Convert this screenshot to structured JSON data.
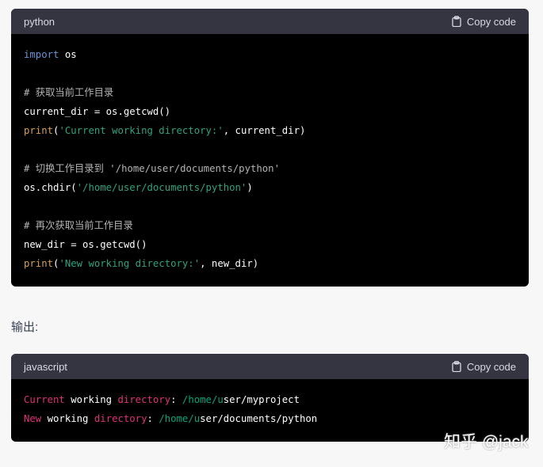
{
  "block1": {
    "lang": "python",
    "copy": "Copy code",
    "lines": [
      [
        {
          "t": "import",
          "c": "kw"
        },
        {
          "t": " os",
          "c": ""
        }
      ],
      [],
      [
        {
          "t": "# 获取当前工作目录",
          "c": "cm"
        }
      ],
      [
        {
          "t": "current_dir = os.getcwd()",
          "c": ""
        }
      ],
      [
        {
          "t": "print",
          "c": "fn"
        },
        {
          "t": "(",
          "c": ""
        },
        {
          "t": "'Current working directory:'",
          "c": "str"
        },
        {
          "t": ", current_dir)",
          "c": ""
        }
      ],
      [],
      [
        {
          "t": "# 切换工作目录到 '/home/user/documents/python'",
          "c": "cm"
        }
      ],
      [
        {
          "t": "os.chdir(",
          "c": ""
        },
        {
          "t": "'/home/user/documents/python'",
          "c": "str"
        },
        {
          "t": ")",
          "c": ""
        }
      ],
      [],
      [
        {
          "t": "# 再次获取当前工作目录",
          "c": "cm"
        }
      ],
      [
        {
          "t": "new_dir = os.getcwd()",
          "c": ""
        }
      ],
      [
        {
          "t": "print",
          "c": "fn"
        },
        {
          "t": "(",
          "c": ""
        },
        {
          "t": "'New working directory:'",
          "c": "str"
        },
        {
          "t": ", new_dir)",
          "c": ""
        }
      ]
    ]
  },
  "output_label": "输出:",
  "block2": {
    "lang": "javascript",
    "copy": "Copy code",
    "lines": [
      [
        {
          "t": "Current",
          "c": "red"
        },
        {
          "t": " working ",
          "c": ""
        },
        {
          "t": "directory",
          "c": "red"
        },
        {
          "t": ": ",
          "c": ""
        },
        {
          "t": "/home/u",
          "c": "grn"
        },
        {
          "t": "ser/myproject",
          "c": ""
        }
      ],
      [
        {
          "t": "New",
          "c": "red"
        },
        {
          "t": " working ",
          "c": ""
        },
        {
          "t": "directory",
          "c": "red"
        },
        {
          "t": ": ",
          "c": ""
        },
        {
          "t": "/home/u",
          "c": "grn"
        },
        {
          "t": "ser/documents/python",
          "c": ""
        }
      ]
    ]
  },
  "watermark": "知乎 @jack"
}
